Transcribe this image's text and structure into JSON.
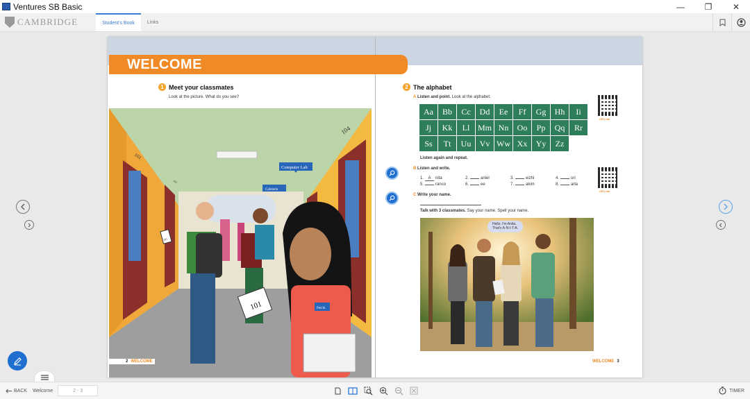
{
  "window": {
    "title": "Ventures SB Basic",
    "controls": {
      "minimize": "—",
      "restore": "❐",
      "close": "✕"
    }
  },
  "toolbar": {
    "brand": "CAMBRIDGE",
    "tabs": [
      {
        "label": "Student's Book",
        "active": true
      },
      {
        "label": "Links",
        "active": false
      }
    ],
    "right_icons": [
      "bookmark-icon",
      "user-profile-icon"
    ]
  },
  "left_page": {
    "banner": "WELCOME",
    "section_number": "1",
    "section_title": "Meet your classmates",
    "instruction": "Look at the picture. What do you see?",
    "illustration_labels": {
      "door_101": "101",
      "door_104": "104",
      "door_103": "103",
      "sign_computer_lab": "Computer Lab",
      "sign_cafeteria": "Cafeteria",
      "card_101": "101",
      "card_small": "101",
      "name_tag": "Peichi"
    },
    "footer_number": "2",
    "footer_label": "WELCOME"
  },
  "right_page": {
    "section_number": "2",
    "section_title": "The alphabet",
    "part_a": {
      "letter": "A",
      "bold": "Listen and point.",
      "rest": " Look at the alphabet."
    },
    "alphabet": [
      "Aa",
      "Bb",
      "Cc",
      "Dd",
      "Ee",
      "Ff",
      "Gg",
      "Hh",
      "Ii",
      "Jj",
      "Kk",
      "Ll",
      "Mm",
      "Nn",
      "Oo",
      "Pp",
      "Qq",
      "Rr",
      "Ss",
      "Tt",
      "Uu",
      "Vv",
      "Ww",
      "Xx",
      "Yy",
      "Zz"
    ],
    "listen_again": "Listen again and repeat.",
    "qr_label": "OR Link",
    "part_b": {
      "letter": "B",
      "title": "Listen and write.",
      "items": [
        {
          "num": "1.",
          "fill": "A",
          "rest": "nita"
        },
        {
          "num": "2.",
          "fill": "",
          "rest": "aniel"
        },
        {
          "num": "3.",
          "fill": "",
          "rest": "eizhi"
        },
        {
          "num": "4.",
          "fill": "",
          "rest": "uri"
        },
        {
          "num": "5.",
          "fill": "",
          "rest": "ranco"
        },
        {
          "num": "6.",
          "fill": "",
          "rest": "ee"
        },
        {
          "num": "7.",
          "fill": "",
          "rest": "akim"
        },
        {
          "num": "8.",
          "fill": "",
          "rest": "arla"
        }
      ]
    },
    "part_c": {
      "letter": "C",
      "title": "Write your name."
    },
    "talk": {
      "bold": "Talk with 3 classmates.",
      "rest": " Say your name. Spell your name."
    },
    "speech_bubble_line1": "Hello. I'm Anita.",
    "speech_bubble_line2": "That's A-N-I-T-A.",
    "footer_label": "WELCOME",
    "footer_number": "3"
  },
  "bottombar": {
    "back_label": "BACK",
    "section_label": "Welcome",
    "page_range": "2 - 3",
    "timer_label": "TIMER",
    "tools": [
      "single-page-icon",
      "double-page-icon",
      "zoom-area-icon",
      "zoom-in-icon",
      "zoom-out-icon",
      "fit-page-icon"
    ]
  },
  "colors": {
    "accent_blue": "#3a7bd5",
    "banner_orange": "#f08a26",
    "alphabet_green": "#2e7d5b",
    "pen_button_blue": "#1e6fd0"
  }
}
